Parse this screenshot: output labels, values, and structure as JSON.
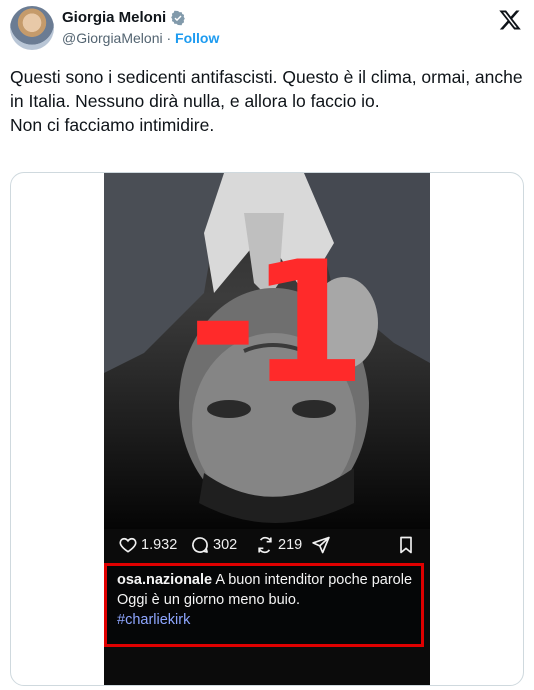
{
  "author": {
    "name": "Giorgia Meloni",
    "handle": "@GiorgiaMeloni",
    "separator": "·",
    "follow_label": "Follow"
  },
  "tweet": {
    "lines": [
      "Questi sono i sedicenti antifascisti. Questo è il clima, ormai, anche in Italia. Nessuno dirà nulla, e allora lo faccio io.",
      "Non ci facciamo intimidire."
    ]
  },
  "embedded_post": {
    "overlay_text": "-1",
    "likes": "1.932",
    "comments": "302",
    "reposts": "219",
    "caption_user": "osa.nazionale",
    "caption_text": "A buon intenditor poche parole",
    "caption_line2": "Oggi è un giorno meno buio.",
    "hashtag": "#charliekirk"
  },
  "colors": {
    "link": "#1d9bf0",
    "overlay_red": "#ff2a2a",
    "caption_border": "#e00000",
    "hashtag": "#8ea6ff"
  },
  "icons": [
    "verified-badge-icon",
    "x-logo-icon",
    "heart-icon",
    "comment-icon",
    "repost-icon",
    "share-icon",
    "bookmark-icon"
  ]
}
